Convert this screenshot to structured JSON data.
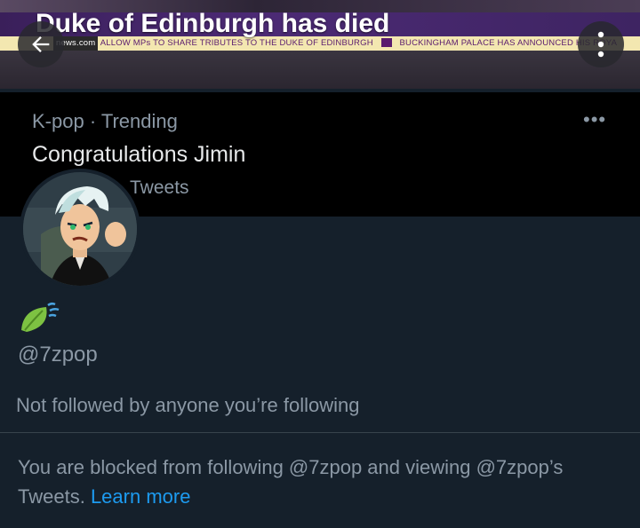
{
  "banner": {
    "headline": "Duke of Edinburgh has died",
    "ticker_source": "news.com",
    "ticker_left": "ALLOW MPs TO SHARE TRIBUTES TO THE DUKE OF EDINBURGH",
    "ticker_right": "BUCKINGHAM PALACE HAS ANNOUNCED HIS ROYA"
  },
  "trending": {
    "meta": "K-pop · Trending",
    "title": "Congratulations Jimin",
    "count": "Tweets"
  },
  "profile": {
    "handle": "@7zpop",
    "followed_status": "Not followed by anyone you’re following",
    "blocked_text": "You are blocked from following @7zpop and viewing @7zpop’s Tweets.",
    "learn_more": "Learn more"
  },
  "colors": {
    "background": "#15202b",
    "link": "#1d9bf0",
    "secondary_text": "#8b98a5"
  }
}
